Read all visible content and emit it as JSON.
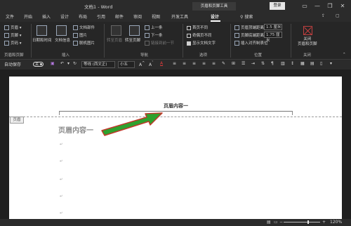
{
  "titlebar": {
    "title": "文档1 - Word",
    "context_tool": "页眉和页脚工具",
    "login": "登录",
    "minimize": "—",
    "restore": "❐",
    "close": "✕"
  },
  "tabs": [
    "文件",
    "开始",
    "插入",
    "设计",
    "布局",
    "引用",
    "邮件",
    "审阅",
    "视图",
    "开发工具",
    "设计"
  ],
  "search_label": "搜索",
  "ribbon": {
    "header_footer_group": {
      "items": [
        "页眉",
        "页脚",
        "页码"
      ],
      "label": "页眉和页脚"
    },
    "insert_group": {
      "date_time": "日期和时间",
      "doc_info": "文档信息",
      "doc_parts": "文档部件",
      "picture": "图片",
      "online_picture": "联机图片",
      "label": "插入"
    },
    "nav_group": {
      "goto_header": "转至页眉",
      "goto_footer": "转至页脚",
      "previous": "上一条",
      "next": "下一条",
      "link_previous": "链接到前一节",
      "label": "导航"
    },
    "options_group": {
      "first_page_diff": "首页不同",
      "odd_even_diff": "奇偶页不同",
      "show_doc_text": "显示文档文字",
      "label": "选项"
    },
    "position_group": {
      "header_top_label": "页眉顶端距离:",
      "header_top_value": "1.5 厘米",
      "footer_bottom_label": "页脚底端距离:",
      "footer_bottom_value": "1.75 厘米",
      "insert_align_tab": "插入对齐制表位",
      "label": "位置"
    },
    "close_group": {
      "close_label": "关闭\n页眉和页脚",
      "label": "关闭"
    }
  },
  "quick_access": {
    "autosave": "自动保存",
    "toggle_state": "关",
    "font_name": "等线 (西文正)",
    "font_size": "小五"
  },
  "document": {
    "header_tag": "页眉",
    "header_text": "页眉内容一",
    "body_heading": "页眉内容一",
    "para_mark": "↵"
  },
  "status": {
    "zoom": "120%",
    "zoom_level": 0.6
  },
  "colors": {
    "arrow": "#2ea12e",
    "arrow_edge": "#c0392b",
    "font_color_red": "#e03c3c"
  }
}
